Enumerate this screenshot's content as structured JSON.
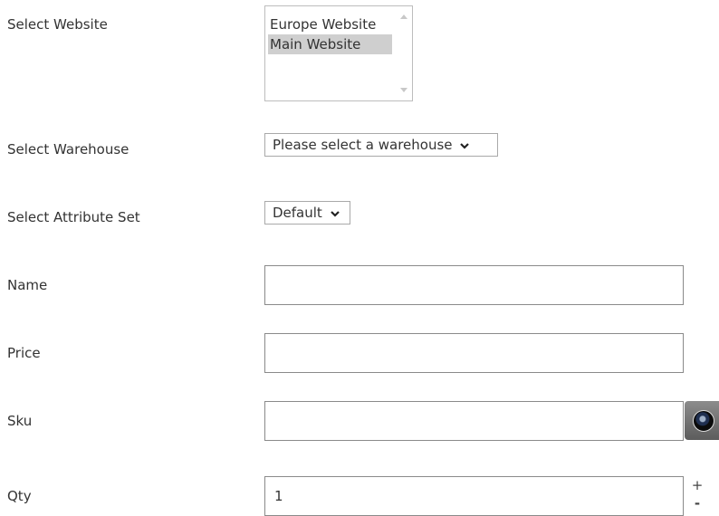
{
  "form": {
    "website": {
      "label": "Select Website",
      "options": [
        "Europe Website",
        "Main Website"
      ],
      "selected": "Main Website"
    },
    "warehouse": {
      "label": "Select Warehouse",
      "selected": "Please select a warehouse"
    },
    "attribute_set": {
      "label": "Select Attribute Set",
      "selected": "Default"
    },
    "name": {
      "label": "Name",
      "value": ""
    },
    "price": {
      "label": "Price",
      "value": ""
    },
    "sku": {
      "label": "Sku",
      "value": ""
    },
    "qty": {
      "label": "Qty",
      "value": "1",
      "increment_label": "+",
      "decrement_label": "-"
    }
  },
  "icons": {
    "sku_scan": "camera-icon",
    "dropdown_chevron": "chevron-down-icon",
    "listbox_scroll_up": "scroll-up-arrow-icon",
    "listbox_scroll_down": "scroll-down-arrow-icon"
  }
}
